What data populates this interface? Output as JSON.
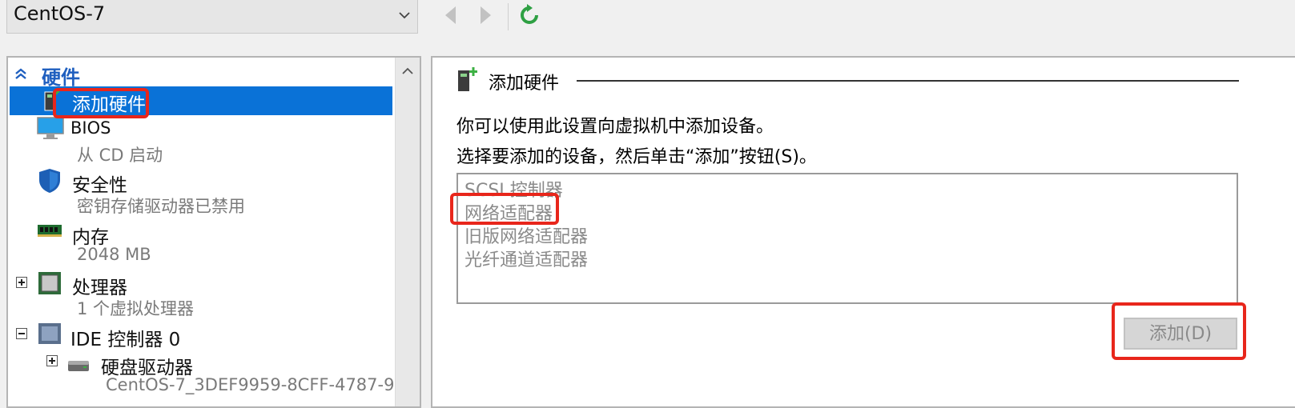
{
  "toolbar": {
    "vm_name": "CentOS-7",
    "icons": {
      "back": "back-arrow-icon",
      "forward": "forward-arrow-icon",
      "refresh": "refresh-icon"
    }
  },
  "tree": {
    "section_header": "硬件",
    "items": [
      {
        "label": "添加硬件",
        "icon": "add-hardware-icon"
      },
      {
        "label": "BIOS",
        "sublabel": "从 CD 启动",
        "icon": "monitor-icon"
      },
      {
        "label": "安全性",
        "sublabel": "密钥存储驱动器已禁用",
        "icon": "shield-icon"
      },
      {
        "label": "内存",
        "sublabel": "2048 MB",
        "icon": "memory-icon"
      },
      {
        "label": "处理器",
        "sublabel": "1 个虚拟处理器",
        "icon": "processor-icon"
      },
      {
        "label": "IDE 控制器 0",
        "icon": "ide-controller-icon"
      },
      {
        "label": "硬盘驱动器",
        "sublabel": "CentOS-7_3DEF9959-8CFF-4787-9",
        "icon": "hard-drive-icon"
      }
    ]
  },
  "detail": {
    "title": "添加硬件",
    "description1": "你可以使用此设置向虚拟机中添加设备。",
    "description2": "选择要添加的设备，然后单击“添加”按钮(S)。",
    "devices": [
      "SCSI 控制器",
      "网络适配器",
      "旧版网络适配器",
      "光纤通道适配器"
    ],
    "add_button": "添加(D)"
  },
  "colors": {
    "selection": "#0a72d7",
    "header": "#1f5fbf",
    "annotation": "#e8261b",
    "refresh": "#2ea043"
  }
}
